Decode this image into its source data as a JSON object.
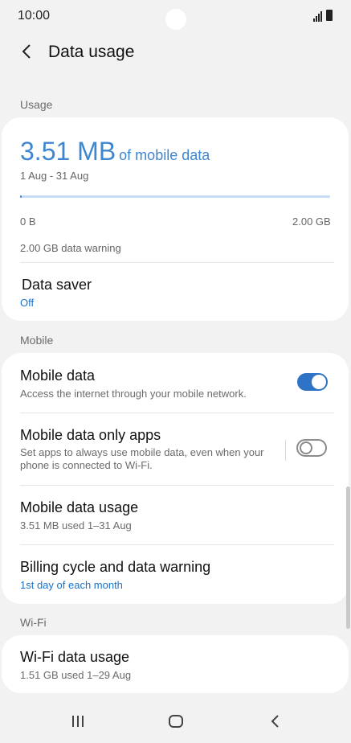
{
  "status": {
    "time": "10:00"
  },
  "header": {
    "title": "Data usage"
  },
  "usage": {
    "section_label": "Usage",
    "amount": "3.51 MB",
    "amount_suffix": "of mobile data",
    "period": "1 Aug - 31 Aug",
    "progress_fraction": 0.0018,
    "min_label": "0 B",
    "max_label": "2.00 GB",
    "warning": "2.00 GB data warning",
    "data_saver": {
      "title": "Data saver",
      "value": "Off"
    }
  },
  "mobile": {
    "section_label": "Mobile",
    "mobile_data": {
      "title": "Mobile data",
      "sub": "Access the internet through your mobile network.",
      "enabled": true
    },
    "data_only_apps": {
      "title": "Mobile data only apps",
      "sub1": "Set apps to always use mobile data, even when your",
      "sub2": "phone is connected to Wi-Fi.",
      "enabled": false
    },
    "mobile_usage": {
      "title": "Mobile data usage",
      "sub": "3.51 MB used 1–31 Aug"
    },
    "billing": {
      "title": "Billing cycle and data warning",
      "sub": "1st day of each month"
    }
  },
  "wifi": {
    "section_label": "Wi-Fi",
    "wifi_usage": {
      "title": "Wi-Fi data usage",
      "sub": "1.51 GB used 1–29 Aug"
    }
  },
  "colors": {
    "accent": "#3e86d0",
    "toggle_on": "#2f73c7",
    "link": "#1a73c9"
  }
}
